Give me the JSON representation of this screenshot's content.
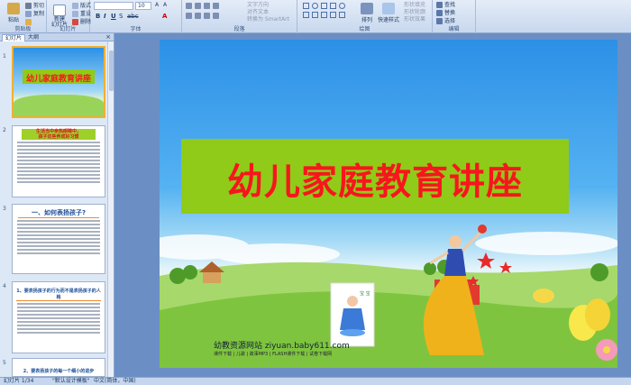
{
  "ribbon": {
    "groups": {
      "clipboard": "剪贴板",
      "slides": "幻灯片",
      "font": "字体",
      "paragraph": "段落",
      "drawing": "绘图",
      "editing": "编辑"
    },
    "paste_label": "粘贴",
    "cut_label": "剪切",
    "copy_label": "复制",
    "new_slide_label": "新建\n幻灯片",
    "layout_label": "版式",
    "reset_label": "重设",
    "delete_label": "删除",
    "font_size": "10",
    "text_direction_label": "文字方向",
    "align_text_label": "对齐文本",
    "convert_smartart_label": "转换为 SmartArt",
    "arrange_label": "排列",
    "quick_styles_label": "快速样式",
    "shape_fill_label": "形状填充",
    "shape_outline_label": "形状轮廓",
    "shape_effects_label": "形状效果",
    "find_label": "查找",
    "replace_label": "替换",
    "select_label": "选择"
  },
  "left_panel": {
    "tabs": [
      "幻灯片",
      "大纲"
    ],
    "close": "×",
    "thumbs": [
      {
        "num": "1",
        "title": "幼儿家庭教育讲座"
      },
      {
        "num": "2",
        "title": "生活当中亲热眼睛中，\n孩子这些养成好习惯"
      },
      {
        "num": "3",
        "title": "一、如何表扬孩子?"
      },
      {
        "num": "4",
        "title": "1、要表扬孩子的行为而不是表扬孩子的人格"
      },
      {
        "num": "5",
        "title": "2、要表扬孩子的每一个细小的进步"
      }
    ]
  },
  "slide": {
    "title": "幼儿家庭教育讲座",
    "website": "幼教资源网站  ziyuan.baby611.com",
    "website_sub": "课件下载 | 儿歌 | 故事MP3 | FLASH课件下载 | 试卷下载网",
    "logo_text": "宝 宝"
  },
  "status": {
    "slide_info": "幻灯片 1/34",
    "theme": "\"默认设计模板\"",
    "language": "中文(简体，中国)"
  },
  "colors": {
    "title_red": "#f7161d",
    "title_box_green": "#8fcb18",
    "workspace_blue": "#6b8fc4"
  }
}
